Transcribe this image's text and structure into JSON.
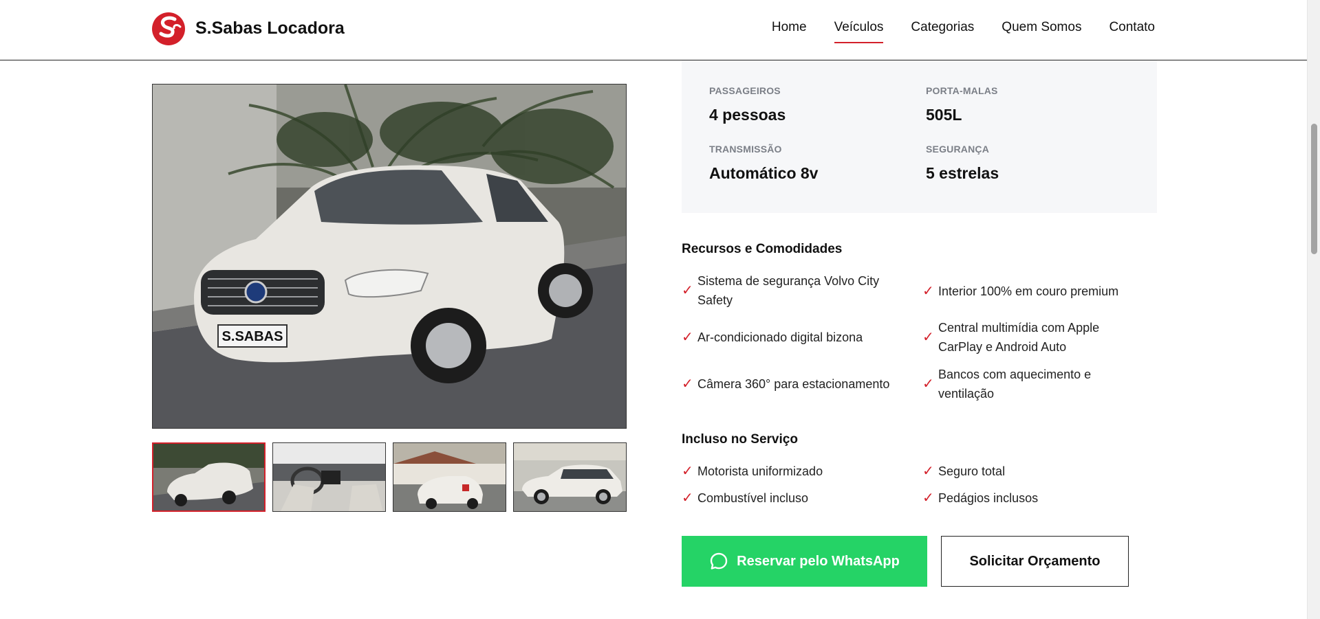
{
  "header": {
    "brand": "S.Sabas Locadora",
    "logo_icon": "ss-logo-icon",
    "nav": [
      "Home",
      "Veículos",
      "Categorias",
      "Quem Somos",
      "Contato"
    ],
    "active_nav": "Veículos"
  },
  "gallery": {
    "plate_text": "S.SABAS",
    "thumbnail_count": 4,
    "active_thumbnail": 1
  },
  "specs": [
    {
      "label": "PASSAGEIROS",
      "value": "4 pessoas"
    },
    {
      "label": "PORTA-MALAS",
      "value": "505L"
    },
    {
      "label": "TRANSMISSÃO",
      "value": "Automático 8v"
    },
    {
      "label": "SEGURANÇA",
      "value": "5 estrelas"
    }
  ],
  "features": {
    "title": "Recursos e Comodidades",
    "items": [
      [
        "Sistema de segurança Volvo City",
        "Safety"
      ],
      [
        "Interior 100% em couro premium"
      ],
      [
        "Ar-condicionado digital bizona"
      ],
      [
        "Central multimídia com Apple",
        "CarPlay e Android Auto"
      ],
      [
        "Câmera 360° para estacionamento"
      ],
      [
        "Bancos com aquecimento e",
        "ventilação"
      ]
    ]
  },
  "included": {
    "title": "Incluso no Serviço",
    "items": [
      "Motorista uniformizado",
      "Seguro total",
      "Combustível incluso",
      "Pedágios inclusos"
    ]
  },
  "buttons": {
    "whatsapp": "Reservar pelo WhatsApp",
    "quote": "Solicitar Orçamento"
  },
  "colors": {
    "accent": "#d3202a",
    "whatsapp": "#25d366",
    "specs_bg": "#f6f7f9"
  }
}
